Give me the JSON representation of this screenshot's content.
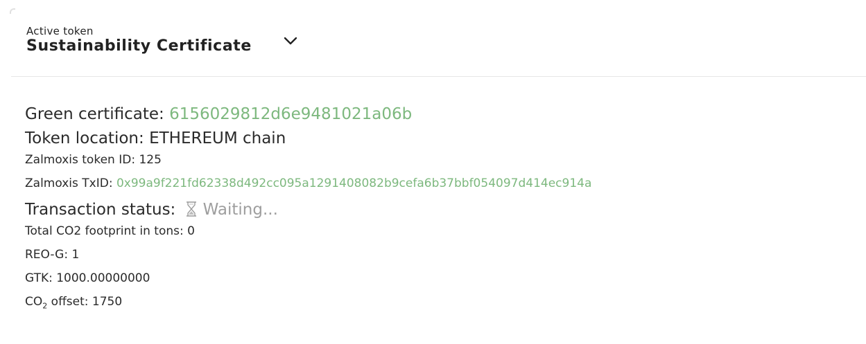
{
  "header": {
    "eyebrow": "Active token",
    "token_name": "Sustainability Certificate",
    "chevron_icon": "chevron-down-icon"
  },
  "details": {
    "green_certificate": {
      "label": "Green certificate: ",
      "value": "6156029812d6e9481021a06b"
    },
    "token_location": {
      "label": "Token location: ",
      "value": "ETHEREUM chain"
    },
    "token_id": {
      "label": "Zalmoxis token ID: ",
      "value": "125"
    },
    "txid": {
      "label": "Zalmoxis TxID: ",
      "value": "0x99a9f221fd62338d492cc095a1291408082b9cefa6b37bbf054097d414ec914a"
    },
    "tx_status": {
      "label": "Transaction status: ",
      "icon": "hourglass-icon",
      "value": "Waiting..."
    },
    "co2_footprint": {
      "label": "Total CO2 footprint in tons: ",
      "value": "0"
    },
    "reo_g": {
      "label": "REO-G: ",
      "value": "1"
    },
    "gtk": {
      "label": "GTK: ",
      "value": "1000.00000000"
    },
    "co2_offset": {
      "label_prefix": "CO",
      "label_sub": "2",
      "label_suffix": " offset: ",
      "value": "1750"
    }
  },
  "colors": {
    "accent_green": "#7db87e",
    "waiting_gray": "#9e9e9e",
    "text": "#222222",
    "divider": "#e6e6e6"
  }
}
